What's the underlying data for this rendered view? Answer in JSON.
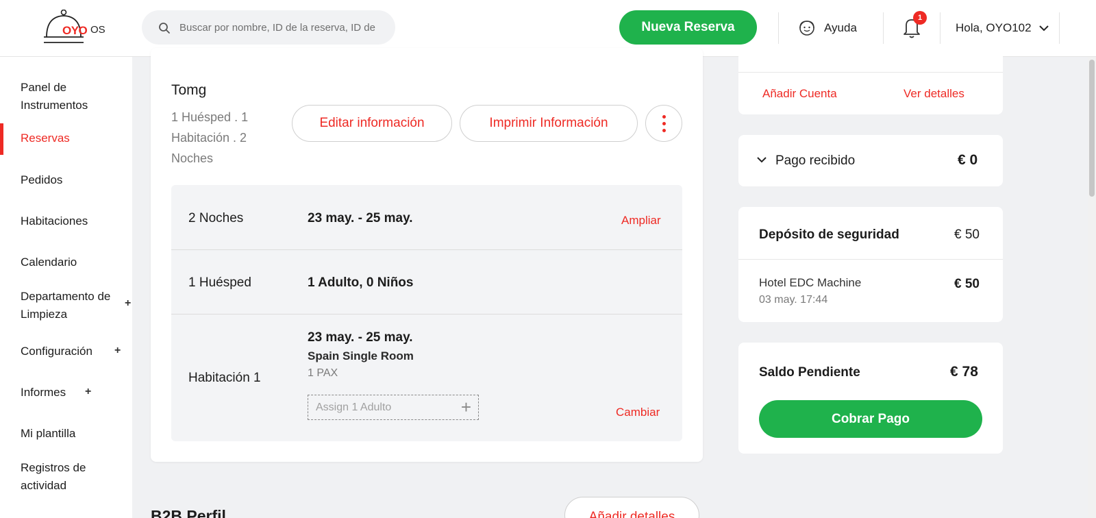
{
  "header": {
    "logo_text": "OYO",
    "logo_os": "OS",
    "search_placeholder": "Buscar por nombre, ID de la reserva, ID de",
    "new_booking": "Nueva Reserva",
    "help": "Ayuda",
    "notifications_count": "1",
    "user_greeting": "Hola, OYO102"
  },
  "sidebar": {
    "items": [
      {
        "label": "Panel de Instrumentos"
      },
      {
        "label": "Reservas",
        "active": true
      },
      {
        "label": "Pedidos"
      },
      {
        "label": "Habitaciones"
      },
      {
        "label": "Calendario"
      },
      {
        "label": "Departamento de Limpieza",
        "plus": "+"
      },
      {
        "label": "Configuración",
        "plus": "+"
      },
      {
        "label": "Informes",
        "plus": "+"
      },
      {
        "label": "Mi plantilla"
      },
      {
        "label": "Registros de actividad"
      }
    ]
  },
  "booking": {
    "guest_name": "Tomg",
    "summary": "1 Huésped . 1 Habitación . 2 Noches",
    "edit_label": "Editar información",
    "print_label": "Imprimir Información",
    "nights_label": "2 Noches",
    "nights_dates": "23 may. - 25 may.",
    "extend_label": "Ampliar",
    "guests_label": "1 Huésped",
    "guests_value": "1 Adulto, 0 Niños",
    "room_label": "Habitación 1",
    "room_dates": "23 may. - 25 may.",
    "room_type": "Spain Single Room",
    "room_pax": "1 PAX",
    "assign_placeholder": "Assign 1 Adulto",
    "change_label": "Cambiar"
  },
  "b2b": {
    "title": "B2B Perfil",
    "add_details": "Añadir detalles"
  },
  "right": {
    "add_account": "Añadir Cuenta",
    "view_details": "Ver detalles",
    "payment_received_label": "Pago recibido",
    "payment_received_value": "€ 0",
    "deposit_label": "Depósito de seguridad",
    "deposit_value": "€ 50",
    "deposit_hotel": "Hotel EDC Machine",
    "deposit_date": "03 may. 17:44",
    "deposit_hotel_value": "€ 50",
    "pending_label": "Saldo Pendiente",
    "pending_value": "€ 78",
    "collect_payment": "Cobrar Pago"
  },
  "colors": {
    "brand_red": "#ee2a24",
    "accent_green": "#1fb24c"
  }
}
